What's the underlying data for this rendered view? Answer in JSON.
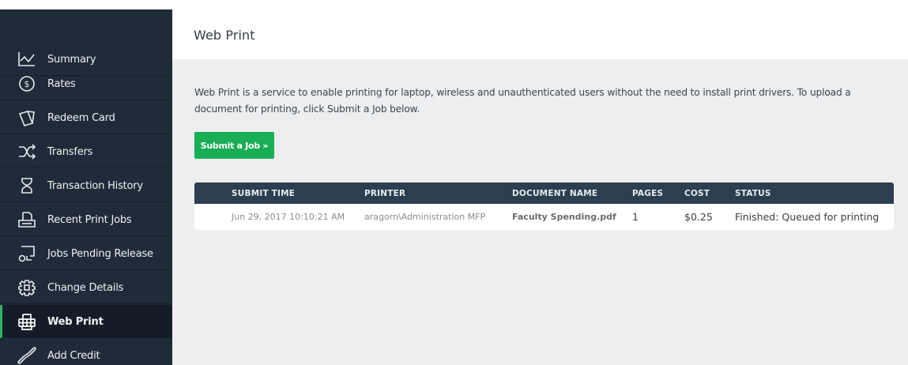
{
  "sidebar": {
    "items": [
      {
        "label": "Summary",
        "icon": "line-chart-icon"
      },
      {
        "label": "Rates",
        "icon": "dollar-circle-icon"
      },
      {
        "label": "Redeem Card",
        "icon": "cards-icon"
      },
      {
        "label": "Transfers",
        "icon": "shuffle-icon"
      },
      {
        "label": "Transaction History",
        "icon": "hourglass-icon"
      },
      {
        "label": "Recent Print Jobs",
        "icon": "print-tray-icon"
      },
      {
        "label": "Jobs Pending Release",
        "icon": "pending-release-icon"
      },
      {
        "label": "Change Details",
        "icon": "gear-icon"
      },
      {
        "label": "Web Print",
        "icon": "web-printer-icon"
      },
      {
        "label": "Add Credit",
        "icon": "link-icon"
      }
    ],
    "active_index": 8
  },
  "page": {
    "title": "Web Print",
    "intro_line1": "Web Print is a service to enable printing for laptop, wireless and unauthenticated users without the need to install print drivers. To upload a",
    "intro_line2": "document for printing, click Submit a Job below.",
    "submit_label": "Submit a Job »"
  },
  "table": {
    "headers": {
      "submit_time": "SUBMIT TIME",
      "printer": "PRINTER",
      "document": "DOCUMENT NAME",
      "pages": "PAGES",
      "cost": "COST",
      "status": "STATUS"
    },
    "rows": [
      {
        "submit_time": "Jun 29, 2017 10:10:21 AM",
        "printer": "aragorn\\Administration MFP",
        "document": "Faculty Spending.pdf",
        "pages": "1",
        "cost": "$0.25",
        "status": "Finished: Queued for printing"
      }
    ]
  },
  "colors": {
    "sidebar_bg": "#1f2b38",
    "active_item_bg": "#141d27",
    "active_accent": "#2fb36a",
    "content_bg": "#eceef0",
    "table_header_bg": "#2c3e50",
    "submit_button": "#19ad55"
  }
}
